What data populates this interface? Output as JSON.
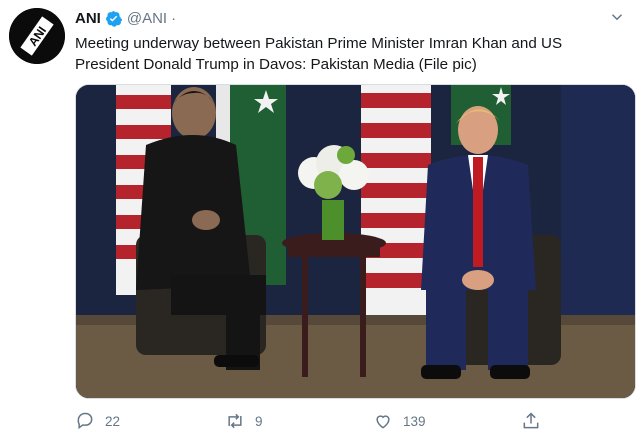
{
  "tweet": {
    "author_name": "ANI",
    "handle": "@ANI",
    "separator": "·",
    "text": "Meeting underway between Pakistan Prime Minister Imran Khan and US President Donald Trump in Davos: Pakistan Media (File pic)",
    "avatar_text": "ANI"
  },
  "actions": {
    "reply_count": "22",
    "retweet_count": "9",
    "like_count": "139"
  },
  "icons": {
    "verified": "verified-badge-icon",
    "caret": "chevron-down-icon",
    "reply": "reply-icon",
    "retweet": "retweet-icon",
    "like": "heart-icon",
    "share": "share-icon"
  },
  "colors": {
    "verified_blue": "#1da1f2",
    "secondary_text": "#657786"
  }
}
